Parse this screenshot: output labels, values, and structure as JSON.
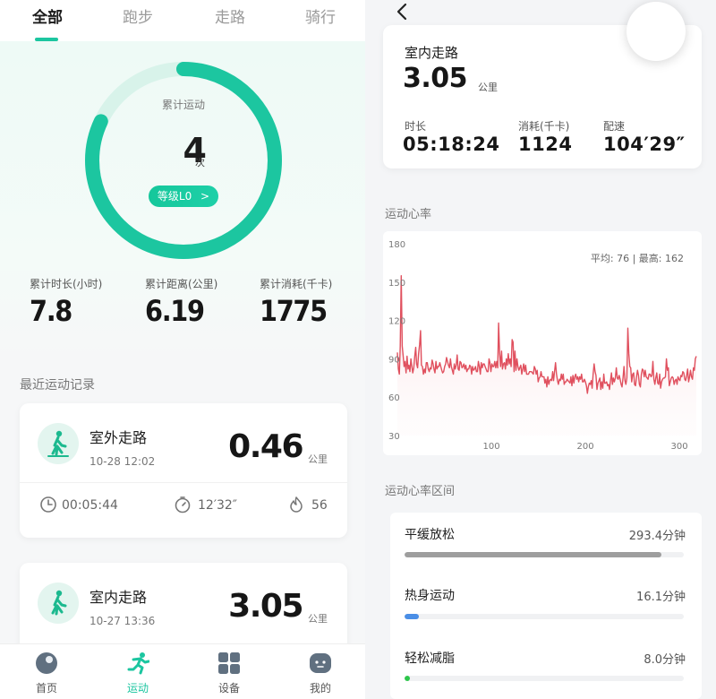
{
  "left": {
    "tabs": [
      {
        "label": "全部",
        "active": true
      },
      {
        "label": "跑步",
        "active": false
      },
      {
        "label": "走路",
        "active": false
      },
      {
        "label": "骑行",
        "active": false
      }
    ],
    "ring": {
      "title": "累计运动",
      "count": "4",
      "unit": "次",
      "progress": 0.82,
      "level_label": "等级L0",
      "level_chevron": ">",
      "accent": "#1cc6a0"
    },
    "stats": [
      {
        "label": "累计时长(小时)",
        "value": "7.8"
      },
      {
        "label": "累计距离(公里)",
        "value": "6.19"
      },
      {
        "label": "累计消耗(千卡)",
        "value": "1775"
      }
    ],
    "recent_title": "最近运动记录",
    "records": [
      {
        "icon": "walking-person-icon",
        "title": "室外走路",
        "date": "10-28 12:02",
        "distance": "0.46",
        "unit": "公里",
        "duration": "00:05:44",
        "pace": "12′32″",
        "calories": "56"
      },
      {
        "icon": "walking-person-icon",
        "title": "室内走路",
        "date": "10-27 13:36",
        "distance": "3.05",
        "unit": "公里"
      }
    ],
    "nav": [
      {
        "label": "首页",
        "icon": "home-planet-icon",
        "active": false
      },
      {
        "label": "运动",
        "icon": "running-icon",
        "active": true
      },
      {
        "label": "设备",
        "icon": "devices-grid-icon",
        "active": false
      },
      {
        "label": "我的",
        "icon": "profile-face-icon",
        "active": false
      }
    ]
  },
  "right": {
    "back_icon": "chevron-left-icon",
    "summary": {
      "title": "室内走路",
      "distance": "3.05",
      "unit": "公里",
      "metrics": [
        {
          "label": "时长",
          "value": "05:18:24"
        },
        {
          "label": "消耗(千卡)",
          "value": "1124"
        },
        {
          "label": "配速",
          "value": "104′29″"
        }
      ]
    },
    "heart_rate_title": "运动心率",
    "heart_rate_summary": "平均: 76 | 最高: 162",
    "zones_title": "运动心率区间",
    "zones": [
      {
        "name": "平缓放松",
        "value": "293.4分钟",
        "fraction": 0.92,
        "color": "#9e9e9e"
      },
      {
        "name": "热身运动",
        "value": "16.1分钟",
        "fraction": 0.05,
        "color": "#4a8ee6"
      },
      {
        "name": "轻松减脂",
        "value": "8.0分钟",
        "fraction": 0.02,
        "color": "#2cc64a"
      }
    ]
  },
  "chart_data": {
    "type": "line",
    "title": "",
    "xlabel": "",
    "ylabel": "",
    "y_ticks": [
      "180",
      "150",
      "120",
      "90",
      "60",
      "30"
    ],
    "x_ticks": [
      "100",
      "200",
      "300"
    ],
    "xlim": [
      0,
      318
    ],
    "ylim": [
      30,
      180
    ],
    "y_tick_values": [
      180,
      150,
      120,
      90,
      60,
      30
    ],
    "x_tick_values": [
      100,
      200,
      300
    ],
    "grid": false,
    "line_color": "#e0505e",
    "series": [
      {
        "values": [
          95,
          82,
          78,
          100,
          155,
          100,
          92,
          84,
          88,
          79,
          92,
          82,
          85,
          80,
          90,
          84,
          79,
          83,
          92,
          99,
          86,
          83,
          94,
          101,
          112,
          85,
          84,
          78,
          82,
          79,
          87,
          87,
          82,
          80,
          83,
          82,
          89,
          86,
          82,
          79,
          88,
          82,
          84,
          84,
          87,
          84,
          81,
          79,
          80,
          84,
          86,
          91,
          88,
          85,
          83,
          90,
          84,
          81,
          78,
          86,
          82,
          85,
          93,
          82,
          81,
          88,
          87,
          83,
          84,
          86,
          82,
          85,
          80,
          82,
          82,
          85,
          84,
          78,
          84,
          81,
          82,
          84,
          80,
          80,
          88,
          84,
          78,
          87,
          83,
          86,
          86,
          84,
          82,
          80,
          80,
          90,
          87,
          80,
          86,
          84,
          84,
          88,
          83,
          88,
          83,
          118,
          95,
          84,
          96,
          82,
          86,
          87,
          82,
          90,
          85,
          94,
          86,
          90,
          84,
          105,
          103,
          80,
          96,
          81,
          90,
          84,
          81,
          83,
          85,
          78,
          82,
          86,
          80,
          85,
          78,
          78,
          78,
          80,
          80,
          80,
          79,
          78,
          84,
          82,
          78,
          81,
          72,
          75,
          76,
          80,
          76,
          76,
          76,
          71,
          74,
          68,
          76,
          70,
          73,
          74,
          73,
          80,
          73,
          80,
          87,
          78,
          73,
          70,
          74,
          73,
          78,
          74,
          78,
          70,
          72,
          72,
          74,
          73,
          72,
          71,
          76,
          69,
          77,
          71,
          76,
          78,
          74,
          76,
          72,
          76,
          74,
          78,
          72,
          72,
          74,
          72,
          69,
          63,
          68,
          71,
          70,
          73,
          67,
          78,
          86,
          80,
          77,
          66,
          71,
          73,
          75,
          66,
          72,
          67,
          78,
          71,
          71,
          72,
          69,
          70,
          66,
          73,
          79,
          70,
          75,
          72,
          75,
          83,
          75,
          74,
          77,
          74,
          70,
          68,
          75,
          84,
          73,
          70,
          75,
          114,
          94,
          84,
          83,
          72,
          78,
          79,
          70,
          69,
          76,
          81,
          77,
          70,
          68,
          78,
          82,
          81,
          76,
          81,
          76,
          75,
          74,
          78,
          78,
          76,
          77,
          88,
          74,
          70,
          75,
          79,
          71,
          70,
          78,
          67,
          72,
          74,
          75,
          75,
          76,
          90,
          81,
          83,
          69,
          72,
          75,
          76,
          75,
          70,
          73,
          74,
          70,
          76,
          74,
          73,
          77,
          76,
          80,
          79,
          74,
          73,
          77,
          82,
          72,
          76,
          81,
          76,
          74,
          83,
          81,
          90,
          92
        ]
      }
    ]
  }
}
